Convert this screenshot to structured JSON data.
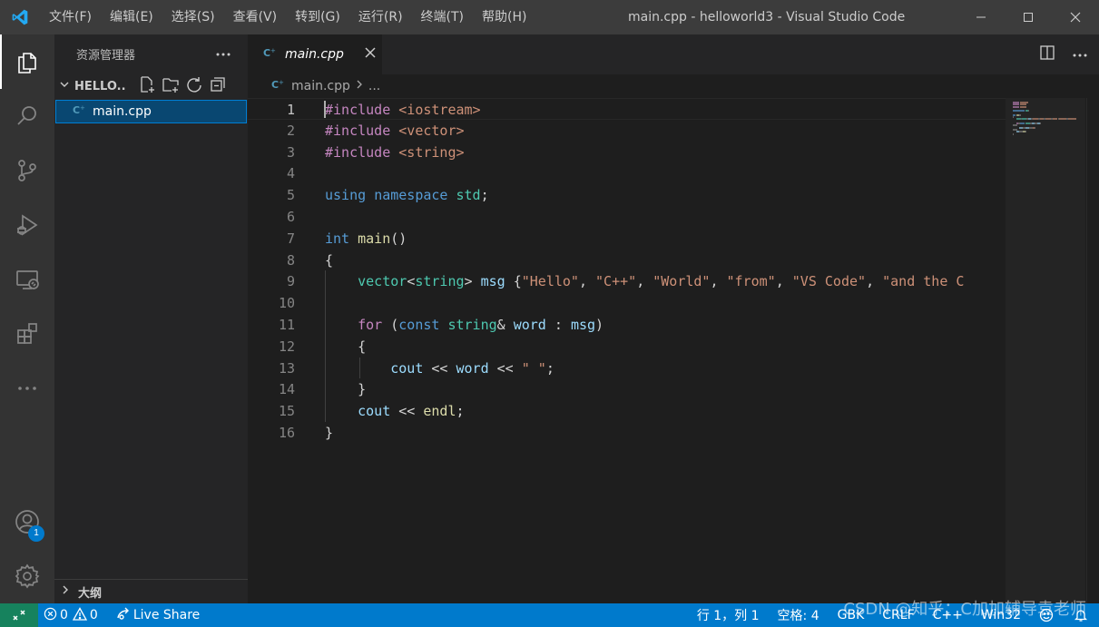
{
  "titlebar": {
    "menus": [
      "文件(F)",
      "编辑(E)",
      "选择(S)",
      "查看(V)",
      "转到(G)",
      "运行(R)",
      "终端(T)",
      "帮助(H)"
    ],
    "title": "main.cpp - helloworld3 - Visual Studio Code"
  },
  "activitybar": {
    "items": [
      "explorer",
      "search",
      "source-control",
      "run-debug",
      "remote-explorer",
      "extensions",
      "more"
    ],
    "accounts_badge": "1"
  },
  "sidebar": {
    "title": "资源管理器",
    "folder": "HELLO...",
    "files": [
      {
        "name": "main.cpp",
        "selected": true
      }
    ],
    "outline_label": "大纲"
  },
  "tabs": [
    {
      "label": "main.cpp",
      "active": true
    }
  ],
  "breadcrumb": {
    "file": "main.cpp",
    "rest": "..."
  },
  "editor": {
    "active_line": 1,
    "lines": [
      {
        "n": "1",
        "tokens": [
          [
            "dir",
            "#include"
          ],
          [
            "pun",
            " "
          ],
          [
            "str",
            "<iostream>"
          ]
        ]
      },
      {
        "n": "2",
        "tokens": [
          [
            "dir",
            "#include"
          ],
          [
            "pun",
            " "
          ],
          [
            "str",
            "<vector>"
          ]
        ]
      },
      {
        "n": "3",
        "tokens": [
          [
            "dir",
            "#include"
          ],
          [
            "pun",
            " "
          ],
          [
            "str",
            "<string>"
          ]
        ]
      },
      {
        "n": "4",
        "tokens": []
      },
      {
        "n": "5",
        "tokens": [
          [
            "kw",
            "using"
          ],
          [
            "pun",
            " "
          ],
          [
            "kw",
            "namespace"
          ],
          [
            "pun",
            " "
          ],
          [
            "type",
            "std"
          ],
          [
            "pun",
            ";"
          ]
        ]
      },
      {
        "n": "6",
        "tokens": []
      },
      {
        "n": "7",
        "tokens": [
          [
            "kw",
            "int"
          ],
          [
            "pun",
            " "
          ],
          [
            "fn",
            "main"
          ],
          [
            "pun",
            "()"
          ]
        ]
      },
      {
        "n": "8",
        "tokens": [
          [
            "pun",
            "{"
          ]
        ]
      },
      {
        "n": "9",
        "tokens": [
          [
            "pun",
            "    "
          ],
          [
            "type",
            "vector"
          ],
          [
            "pun",
            "<"
          ],
          [
            "type",
            "string"
          ],
          [
            "pun",
            "> "
          ],
          [
            "var",
            "msg"
          ],
          [
            "pun",
            " {"
          ],
          [
            "str",
            "\"Hello\""
          ],
          [
            "pun",
            ", "
          ],
          [
            "str",
            "\"C++\""
          ],
          [
            "pun",
            ", "
          ],
          [
            "str",
            "\"World\""
          ],
          [
            "pun",
            ", "
          ],
          [
            "str",
            "\"from\""
          ],
          [
            "pun",
            ", "
          ],
          [
            "str",
            "\"VS Code\""
          ],
          [
            "pun",
            ", "
          ],
          [
            "str",
            "\"and the C"
          ]
        ]
      },
      {
        "n": "10",
        "tokens": []
      },
      {
        "n": "11",
        "tokens": [
          [
            "pun",
            "    "
          ],
          [
            "ctl",
            "for"
          ],
          [
            "pun",
            " ("
          ],
          [
            "kw",
            "const"
          ],
          [
            "pun",
            " "
          ],
          [
            "type",
            "string"
          ],
          [
            "pun",
            "& "
          ],
          [
            "var",
            "word"
          ],
          [
            "pun",
            " : "
          ],
          [
            "var",
            "msg"
          ],
          [
            "pun",
            ")"
          ]
        ]
      },
      {
        "n": "12",
        "tokens": [
          [
            "pun",
            "    {"
          ]
        ]
      },
      {
        "n": "13",
        "tokens": [
          [
            "pun",
            "        "
          ],
          [
            "var",
            "cout"
          ],
          [
            "pun",
            " << "
          ],
          [
            "var",
            "word"
          ],
          [
            "pun",
            " << "
          ],
          [
            "str",
            "\" \""
          ],
          [
            "pun",
            ";"
          ]
        ]
      },
      {
        "n": "14",
        "tokens": [
          [
            "pun",
            "    }"
          ]
        ]
      },
      {
        "n": "15",
        "tokens": [
          [
            "pun",
            "    "
          ],
          [
            "var",
            "cout"
          ],
          [
            "pun",
            " << "
          ],
          [
            "fn",
            "endl"
          ],
          [
            "pun",
            ";"
          ]
        ]
      },
      {
        "n": "16",
        "tokens": [
          [
            "pun",
            "}"
          ]
        ]
      }
    ]
  },
  "statusbar": {
    "errors": "0",
    "warnings": "0",
    "live_share": "Live Share",
    "position": "行 1，列 1",
    "indent": "空格: 4",
    "encoding": "GBK",
    "eol": "CRLF",
    "language": "C++",
    "platform": "Win32"
  },
  "watermark": "CSDN @知乎：C加加辅导袁老师",
  "colors": {
    "accent": "#007acc",
    "remote": "#16825d",
    "selection": "#094771"
  }
}
